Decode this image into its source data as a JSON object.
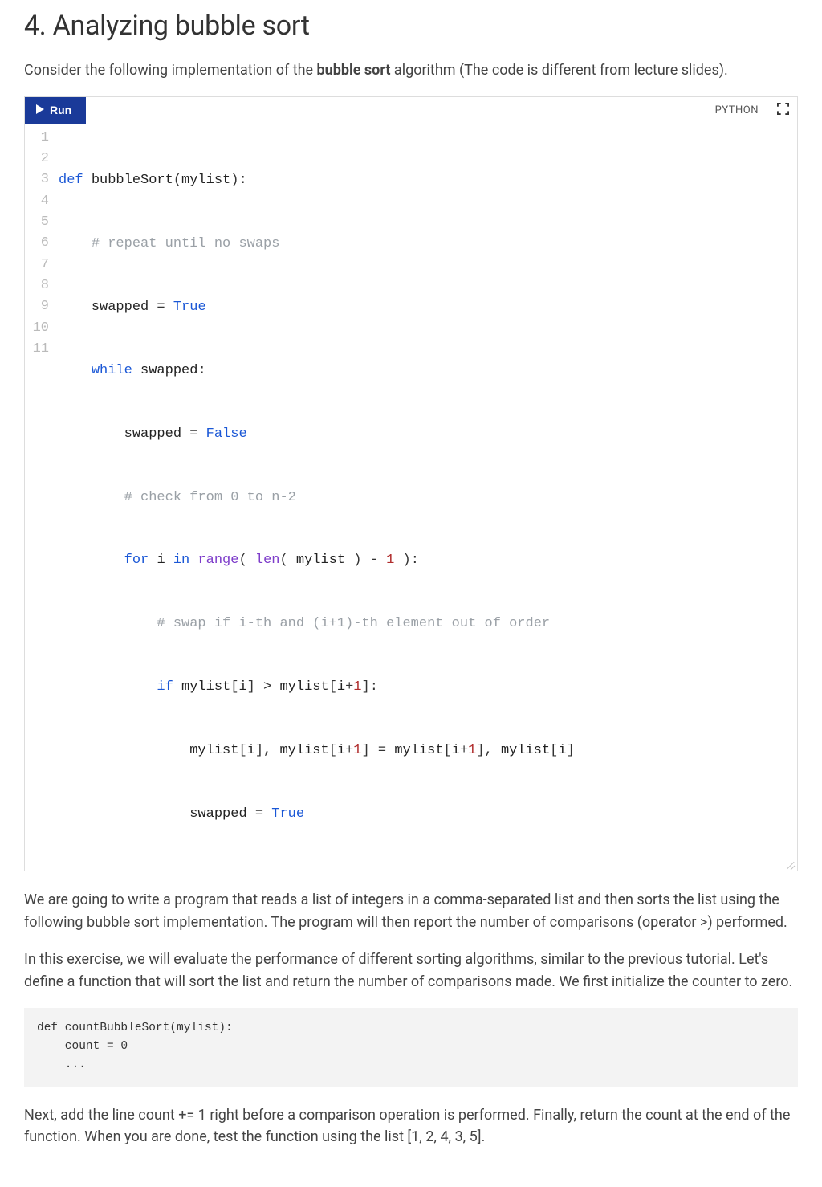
{
  "heading": "4. Analyzing bubble sort",
  "intro": {
    "pre": "Consider the following implementation of the ",
    "bold": "bubble sort",
    "post": " algorithm (The code is different from lecture slides)."
  },
  "runner": {
    "run_label": "Run",
    "language_label": "PYTHON",
    "line_numbers": [
      "1",
      "2",
      "3",
      "4",
      "5",
      "6",
      "7",
      "8",
      "9",
      "10",
      "11"
    ],
    "code_plain": "def bubbleSort(mylist):\n    # repeat until no swaps\n    swapped = True\n    while swapped:\n        swapped = False\n        # check from 0 to n-2\n        for i in range( len( mylist ) - 1 ):\n            # swap if i-th and (i+1)-th element out of order\n            if mylist[i] > mylist[i+1]:\n                mylist[i], mylist[i+1] = mylist[i+1], mylist[i]\n                swapped = True"
  },
  "para2": "We are going to write a program that reads a list of integers in a comma-separated list and then sorts the list using the following bubble sort implementation. The program will then report the number of comparisons (operator >) performed.",
  "para3": "In this exercise, we will evaluate the performance of different sorting algorithms, similar to the previous tutorial. Let's define a function that will sort the list and return the number of comparisons made. We first initialize the counter to zero.",
  "snippet": "def countBubbleSort(mylist):\n    count = 0\n    ...",
  "para4": "Next, add the line count += 1 right before a comparison operation is performed. Finally, return the count at the end of the function. When you are done, test the function using the list [1, 2, 4, 3, 5]."
}
